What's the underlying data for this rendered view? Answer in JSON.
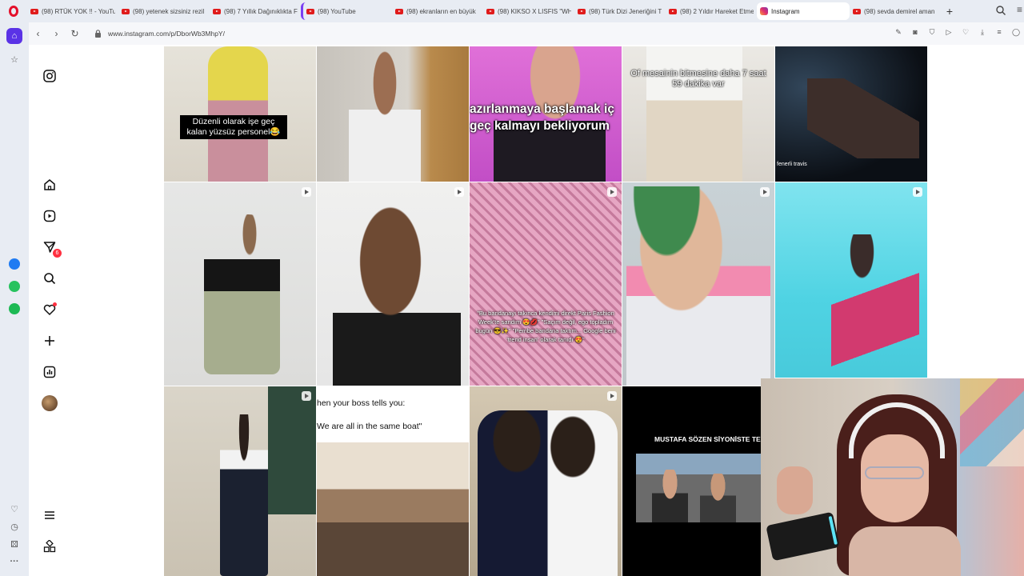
{
  "browser": {
    "tabs": [
      {
        "label": "(98) RTÜK YOK !! - YouTub",
        "favicon": "youtube-icon"
      },
      {
        "label": "(98) yetenek sizsiniz rezil",
        "favicon": "youtube-icon"
      },
      {
        "label": "(98) 7 Yıllık Dağınıklıkta F",
        "favicon": "youtube-icon"
      },
      {
        "label": "(98) YouTube",
        "favicon": "youtube-icon"
      },
      {
        "label": "(98) ekranların en büyük",
        "favicon": "youtube-icon"
      },
      {
        "label": "(98) KIKSO X LISFIS \"WH'",
        "favicon": "youtube-icon"
      },
      {
        "label": "(98) Türk Dizi Jeneriğini T",
        "favicon": "youtube-icon"
      },
      {
        "label": "(98) 2 Yıldır Hareket Etme",
        "favicon": "youtube-icon"
      },
      {
        "label": "Instagram",
        "favicon": "instagram-icon",
        "active": true
      },
      {
        "label": "(98) sevda demirel aman",
        "favicon": "youtube-icon"
      }
    ],
    "new_tab_label": "+",
    "url": "www.instagram.com/p/DborWb3MhpY/"
  },
  "instagram_nav": {
    "messages_badge": "6"
  },
  "grid": {
    "posts": [
      {
        "caption": "Düzenli olarak işe geç kalan yüzsüz personel😂"
      },
      {
        "caption": ""
      },
      {
        "caption": "azırlanmaya başlamak iç geç kalmayı bekliyorum"
      },
      {
        "caption": "Of mesainin bitmesine daha 7 saat 59 dakika var"
      },
      {
        "caption": "fenerli travis"
      },
      {
        "caption": ""
      },
      {
        "caption": ""
      },
      {
        "caption": "\"Bu bandanayı takınca kendimi direkt Paris Fashion Week'te sandım 😍💋\" \"Saçım değil, ego topladım bugün 😎✨\" \"Pembe bandana taktım... Google beni 'trend insan' olarak tanıdı 😍\""
      },
      {
        "caption": ""
      },
      {
        "caption": ""
      },
      {
        "caption": ""
      },
      {
        "caption_line1": "hen your boss tells you:",
        "caption_line2": "We are all in the same boat\""
      },
      {
        "caption": ""
      },
      {
        "caption": "MUSTAFA SÖZEN SİYONİSTE TEPKİ"
      }
    ]
  },
  "colors": {
    "opera_red": "#e4102b",
    "opera_accent": "#5a32e6",
    "notification_red": "#ff3040"
  }
}
